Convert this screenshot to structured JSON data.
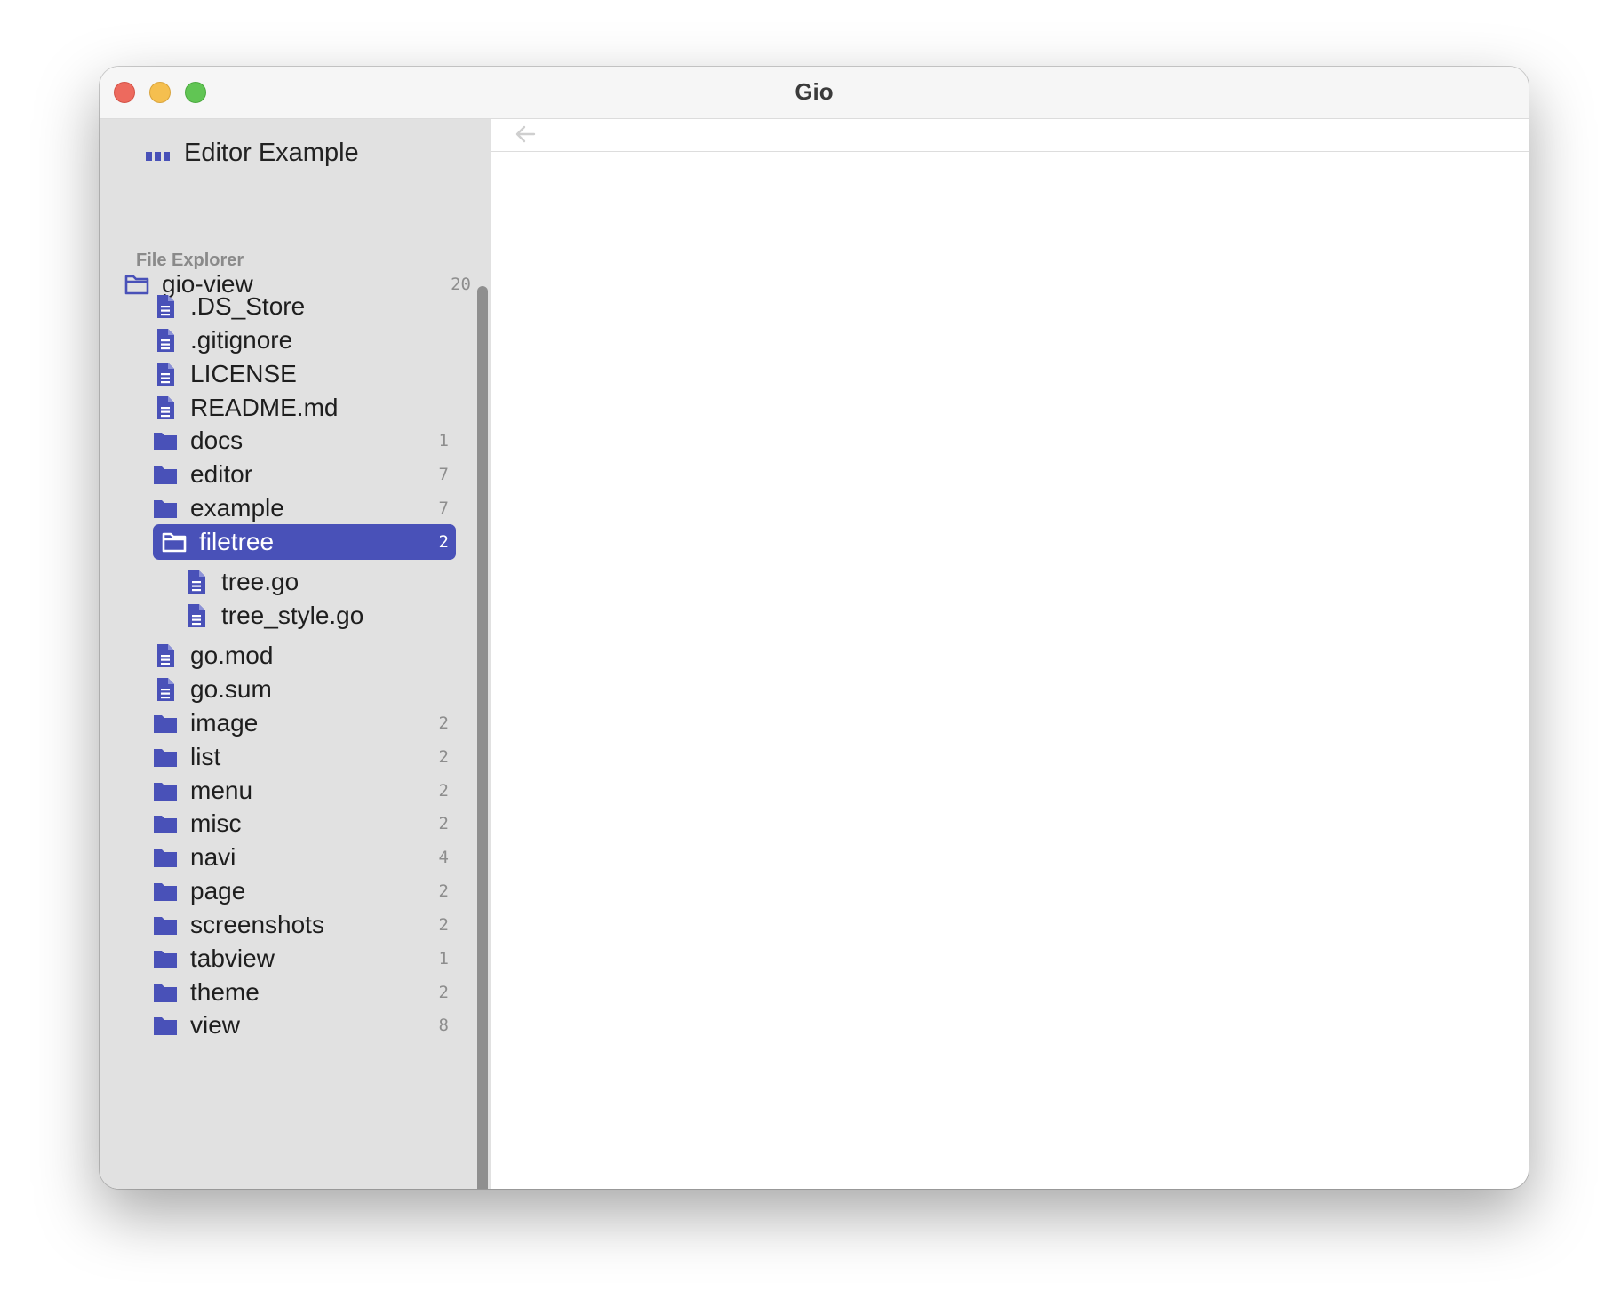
{
  "window": {
    "title": "Gio"
  },
  "sidebar": {
    "header_title": "Editor Example",
    "section_label": "File Explorer",
    "root": {
      "label": "gio-view",
      "count": "20"
    },
    "items": [
      {
        "label": ".DS_Store",
        "type": "file",
        "count": ""
      },
      {
        "label": ".gitignore",
        "type": "file",
        "count": ""
      },
      {
        "label": "LICENSE",
        "type": "file",
        "count": ""
      },
      {
        "label": "README.md",
        "type": "file",
        "count": ""
      },
      {
        "label": "docs",
        "type": "folder",
        "count": "1"
      },
      {
        "label": "editor",
        "type": "folder",
        "count": "7"
      },
      {
        "label": "example",
        "type": "folder",
        "count": "7"
      },
      {
        "label": "filetree",
        "type": "folder-open",
        "count": "2",
        "selected": true
      },
      {
        "label": "tree.go",
        "type": "file",
        "count": "",
        "depth": 2
      },
      {
        "label": "tree_style.go",
        "type": "file",
        "count": "",
        "depth": 2
      },
      {
        "label": "go.mod",
        "type": "file",
        "count": ""
      },
      {
        "label": "go.sum",
        "type": "file",
        "count": ""
      },
      {
        "label": "image",
        "type": "folder",
        "count": "2"
      },
      {
        "label": "list",
        "type": "folder",
        "count": "2"
      },
      {
        "label": "menu",
        "type": "folder",
        "count": "2"
      },
      {
        "label": "misc",
        "type": "folder",
        "count": "2"
      },
      {
        "label": "navi",
        "type": "folder",
        "count": "4"
      },
      {
        "label": "page",
        "type": "folder",
        "count": "2"
      },
      {
        "label": "screenshots",
        "type": "folder",
        "count": "2"
      },
      {
        "label": "tabview",
        "type": "folder",
        "count": "1"
      },
      {
        "label": "theme",
        "type": "folder",
        "count": "2"
      },
      {
        "label": "view",
        "type": "folder",
        "count": "8"
      }
    ]
  },
  "main": {
    "back_icon": "arrow-left-icon"
  },
  "colors": {
    "accent": "#4951b8",
    "sidebar_bg": "#e1e1e1",
    "close": "#ed6a5e",
    "minimize": "#f5bf4f",
    "maximize": "#61c554"
  }
}
